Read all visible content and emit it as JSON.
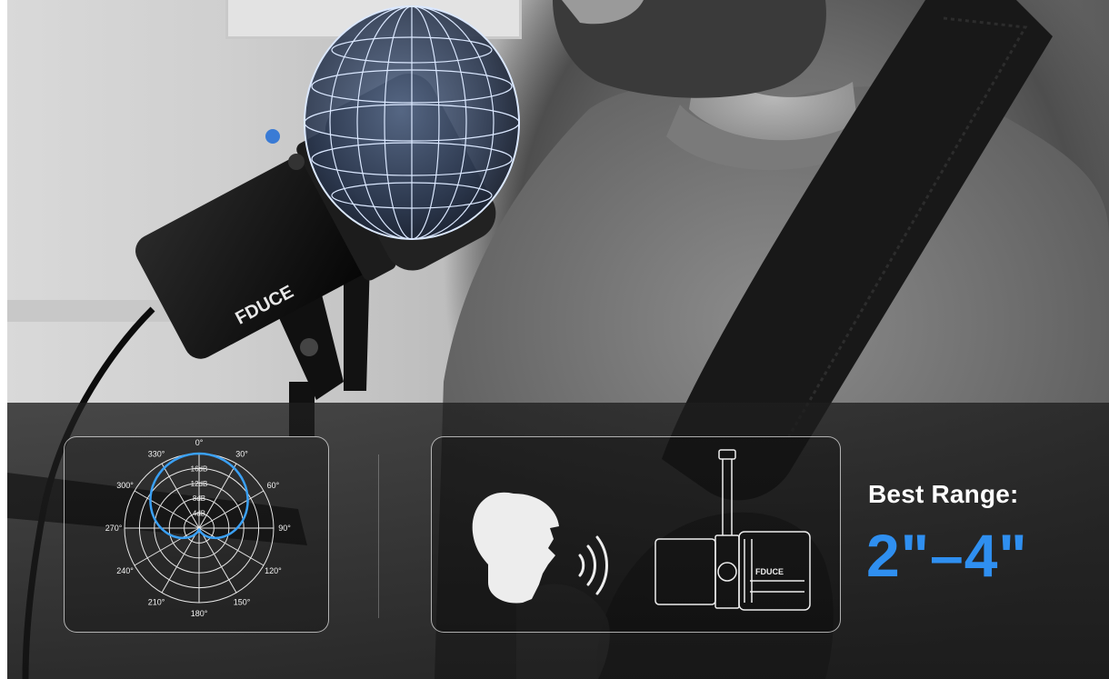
{
  "brand": "FDUCE",
  "polar_chart": {
    "angle_labels": [
      "0°",
      "30°",
      "60°",
      "90°",
      "120°",
      "150°",
      "180°",
      "210°",
      "240°",
      "270°",
      "300°",
      "330°"
    ],
    "ring_labels": [
      "4dB",
      "8dB",
      "12dB",
      "16dB"
    ]
  },
  "range": {
    "title": "Best Range:",
    "value": "2\"–4\""
  },
  "colors": {
    "accent_blue": "#2f8ff0",
    "polar_curve": "#3aa0f5",
    "panel_border": "#ffffff"
  },
  "icons": [
    "microphone-icon",
    "head-speaking-icon",
    "sound-waves-icon",
    "polar-pattern-icon"
  ]
}
